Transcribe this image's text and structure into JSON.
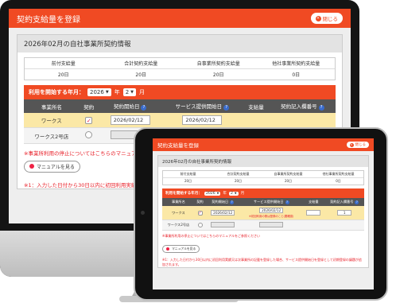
{
  "app": {
    "title": "契約支給量を登録",
    "close_label": "閉じる",
    "close_icon": "close-icon"
  },
  "panel": {
    "title": "2026年02月の自社事業所契約情報"
  },
  "summary": {
    "headers": [
      "前付支給量",
      "合計契約支給量",
      "自事業所契約支給量",
      "他社事業所契約支給量"
    ],
    "values": [
      "20日",
      "20日",
      "20日",
      "0日"
    ]
  },
  "start_month": {
    "label": "利用を開始する年月：",
    "year": "2026",
    "year_unit": "年",
    "month": "2",
    "month_unit": "月"
  },
  "table": {
    "headers": [
      "事業所名",
      "契約",
      "契約開始日",
      "サービス提供開始日",
      "支給量",
      "契約記入欄番号"
    ],
    "rows": [
      {
        "name": "ワークス",
        "contract_date": "2026/02/12",
        "service_date": "2026/02/12"
      },
      {
        "name": "ワークス2号店"
      }
    ],
    "tablet_rows": [
      {
        "name": "ワークス",
        "contract_date": "2026/02/12",
        "service_date": "2026/02/12",
        "warning": "※初回利用の際は登録のこと(要確認)",
        "supply_value": "1"
      },
      {
        "name": "ワークス2号店"
      }
    ]
  },
  "notes": {
    "desktop_note1": "※事業所利用の停止についてはこちらのマニュアルを",
    "manual_button": "マニュアルを見る",
    "desktop_note2": "※1：入力した日付から30日以内に初回利用実績又は次",
    "tablet_note1": "※事業所利用の停止についてはこちらのマニュアルをご参照ください",
    "tablet_note2": "※1：入力した日付から30日以内に初回利用実績又は次事業所の記載を登録した場合、サービス提供開始日を登録として初期登録の議題が追加されます。"
  },
  "colors": {
    "header": "#f04a23",
    "active_row": "#fbe8a6",
    "table_header": "#555555"
  }
}
